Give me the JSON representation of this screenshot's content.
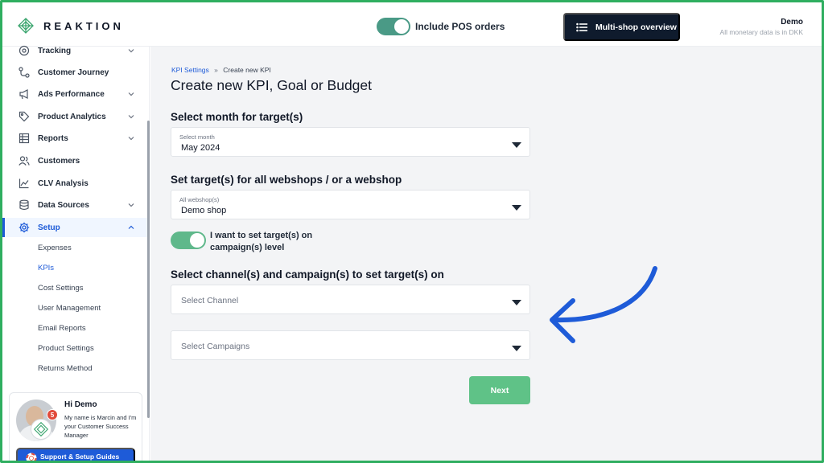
{
  "app": {
    "brand": "REAKTION"
  },
  "topbar": {
    "pos_label": "Include POS orders",
    "multishop_label": "Multi-shop overview",
    "user_name": "Demo",
    "currency_note": "All monetary data is in DKK"
  },
  "sidebar": {
    "items": [
      {
        "label": "Tracking",
        "icon": "target-icon",
        "has_chevron": true
      },
      {
        "label": "Customer Journey",
        "icon": "journey-icon",
        "has_chevron": false
      },
      {
        "label": "Ads Performance",
        "icon": "megaphone-icon",
        "has_chevron": true
      },
      {
        "label": "Product Analytics",
        "icon": "tag-icon",
        "has_chevron": true
      },
      {
        "label": "Reports",
        "icon": "table-icon",
        "has_chevron": true
      },
      {
        "label": "Customers",
        "icon": "users-icon",
        "has_chevron": false
      },
      {
        "label": "CLV Analysis",
        "icon": "chart-line-icon",
        "has_chevron": false
      },
      {
        "label": "Data Sources",
        "icon": "database-icon",
        "has_chevron": true
      },
      {
        "label": "Setup",
        "icon": "gear-icon",
        "has_chevron": true,
        "active": true
      }
    ],
    "sub_items": [
      "Expenses",
      "KPIs",
      "Cost Settings",
      "User Management",
      "Email Reports",
      "Product Settings",
      "Returns Method"
    ],
    "active_sub": "KPIs"
  },
  "support": {
    "greeting": "Hi Demo",
    "intro": "My name is Marcin and I'm your Customer Success Manager",
    "badge_count": "5",
    "button_label": "Support & Setup Guides"
  },
  "main": {
    "breadcrumb": {
      "parent": "KPI Settings",
      "separator": "»",
      "current": "Create new KPI"
    },
    "title": "Create new KPI, Goal or Budget",
    "month_section": "Select month for target(s)",
    "month_select": {
      "label": "Select month",
      "value": "May 2024"
    },
    "shop_section": "Set target(s) for all webshops / or a webshop",
    "shop_select": {
      "label": "All webshop(s)",
      "value": "Demo shop"
    },
    "campaign_toggle_label": "I want to set target(s) on campaign(s) level",
    "channel_section": "Select channel(s) and campaign(s) to set target(s) on",
    "channel_placeholder": "Select Channel",
    "campaign_placeholder": "Select Campaigns",
    "next_label": "Next"
  },
  "colors": {
    "accent_blue": "#1e5bd8",
    "toggle_green": "#5fb88b",
    "next_green": "#5fc287",
    "dark_navy": "#0f1b2d",
    "frame_green": "#2fae60"
  }
}
